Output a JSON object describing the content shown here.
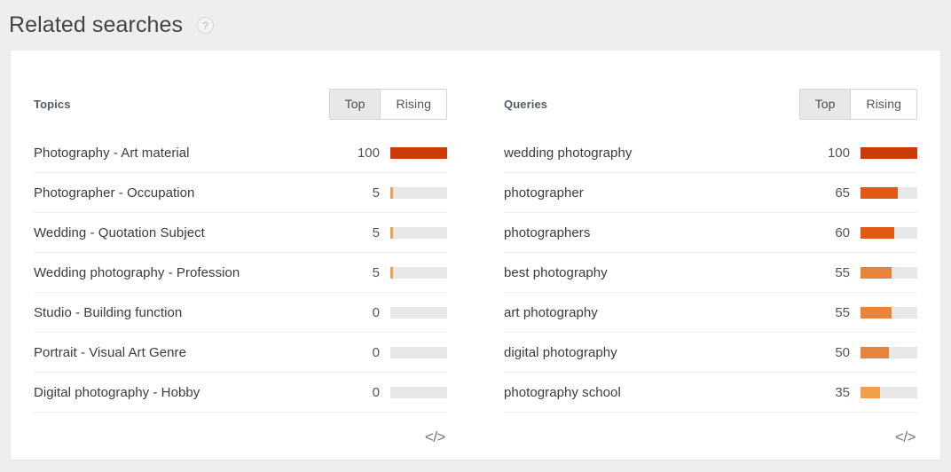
{
  "header": {
    "title": "Related searches",
    "help_icon": "question-mark-icon",
    "help_label": "?"
  },
  "colors": {
    "page_background": "#eeeeee",
    "card_background": "#ffffff",
    "bar_track": "#e8e8e8",
    "bar_100": "#cc3a06",
    "bar_high": "#e05a16",
    "bar_mid": "#e8833a",
    "bar_low": "#f0a04a",
    "toggle_selected": "#e8e8e8",
    "row_divider": "#f1f1f3",
    "title_text": "#444444",
    "label_text": "#3b3b3b"
  },
  "panels": [
    {
      "id": "topics",
      "title": "Topics",
      "toggle": {
        "options": [
          "Top",
          "Rising"
        ],
        "selected": "Top"
      },
      "embed_icon": "code-embed-icon",
      "embed_glyph": "</>",
      "rows": [
        {
          "label": "Photography - Art material",
          "value": "100",
          "percent": 100
        },
        {
          "label": "Photographer - Occupation",
          "value": "5",
          "percent": 5
        },
        {
          "label": "Wedding - Quotation Subject",
          "value": "5",
          "percent": 5
        },
        {
          "label": "Wedding photography - Profession",
          "value": "5",
          "percent": 5
        },
        {
          "label": "Studio - Building function",
          "value": "0",
          "percent": 0
        },
        {
          "label": "Portrait - Visual Art Genre",
          "value": "0",
          "percent": 0
        },
        {
          "label": "Digital photography - Hobby",
          "value": "0",
          "percent": 0
        }
      ]
    },
    {
      "id": "queries",
      "title": "Queries",
      "toggle": {
        "options": [
          "Top",
          "Rising"
        ],
        "selected": "Top"
      },
      "embed_icon": "code-embed-icon",
      "embed_glyph": "</>",
      "rows": [
        {
          "label": "wedding photography",
          "value": "100",
          "percent": 100
        },
        {
          "label": "photographer",
          "value": "65",
          "percent": 65
        },
        {
          "label": "photographers",
          "value": "60",
          "percent": 60
        },
        {
          "label": "best photography",
          "value": "55",
          "percent": 55
        },
        {
          "label": "art photography",
          "value": "55",
          "percent": 55
        },
        {
          "label": "digital photography",
          "value": "50",
          "percent": 50
        },
        {
          "label": "photography school",
          "value": "35",
          "percent": 35
        }
      ]
    }
  ],
  "chart_data": {
    "type": "bar",
    "title": "Related searches",
    "charts": [
      {
        "name": "Topics",
        "mode": "Top",
        "categories": [
          "Photography - Art material",
          "Photographer - Occupation",
          "Wedding - Quotation Subject",
          "Wedding photography - Profession",
          "Studio - Building function",
          "Portrait - Visual Art Genre",
          "Digital photography - Hobby"
        ],
        "values": [
          100,
          5,
          5,
          5,
          0,
          0,
          0
        ],
        "ylim": [
          0,
          100
        ]
      },
      {
        "name": "Queries",
        "mode": "Top",
        "categories": [
          "wedding photography",
          "photographer",
          "photographers",
          "best photography",
          "art photography",
          "digital photography",
          "photography school"
        ],
        "values": [
          100,
          65,
          60,
          55,
          55,
          50,
          35
        ],
        "ylim": [
          0,
          100
        ]
      }
    ]
  }
}
